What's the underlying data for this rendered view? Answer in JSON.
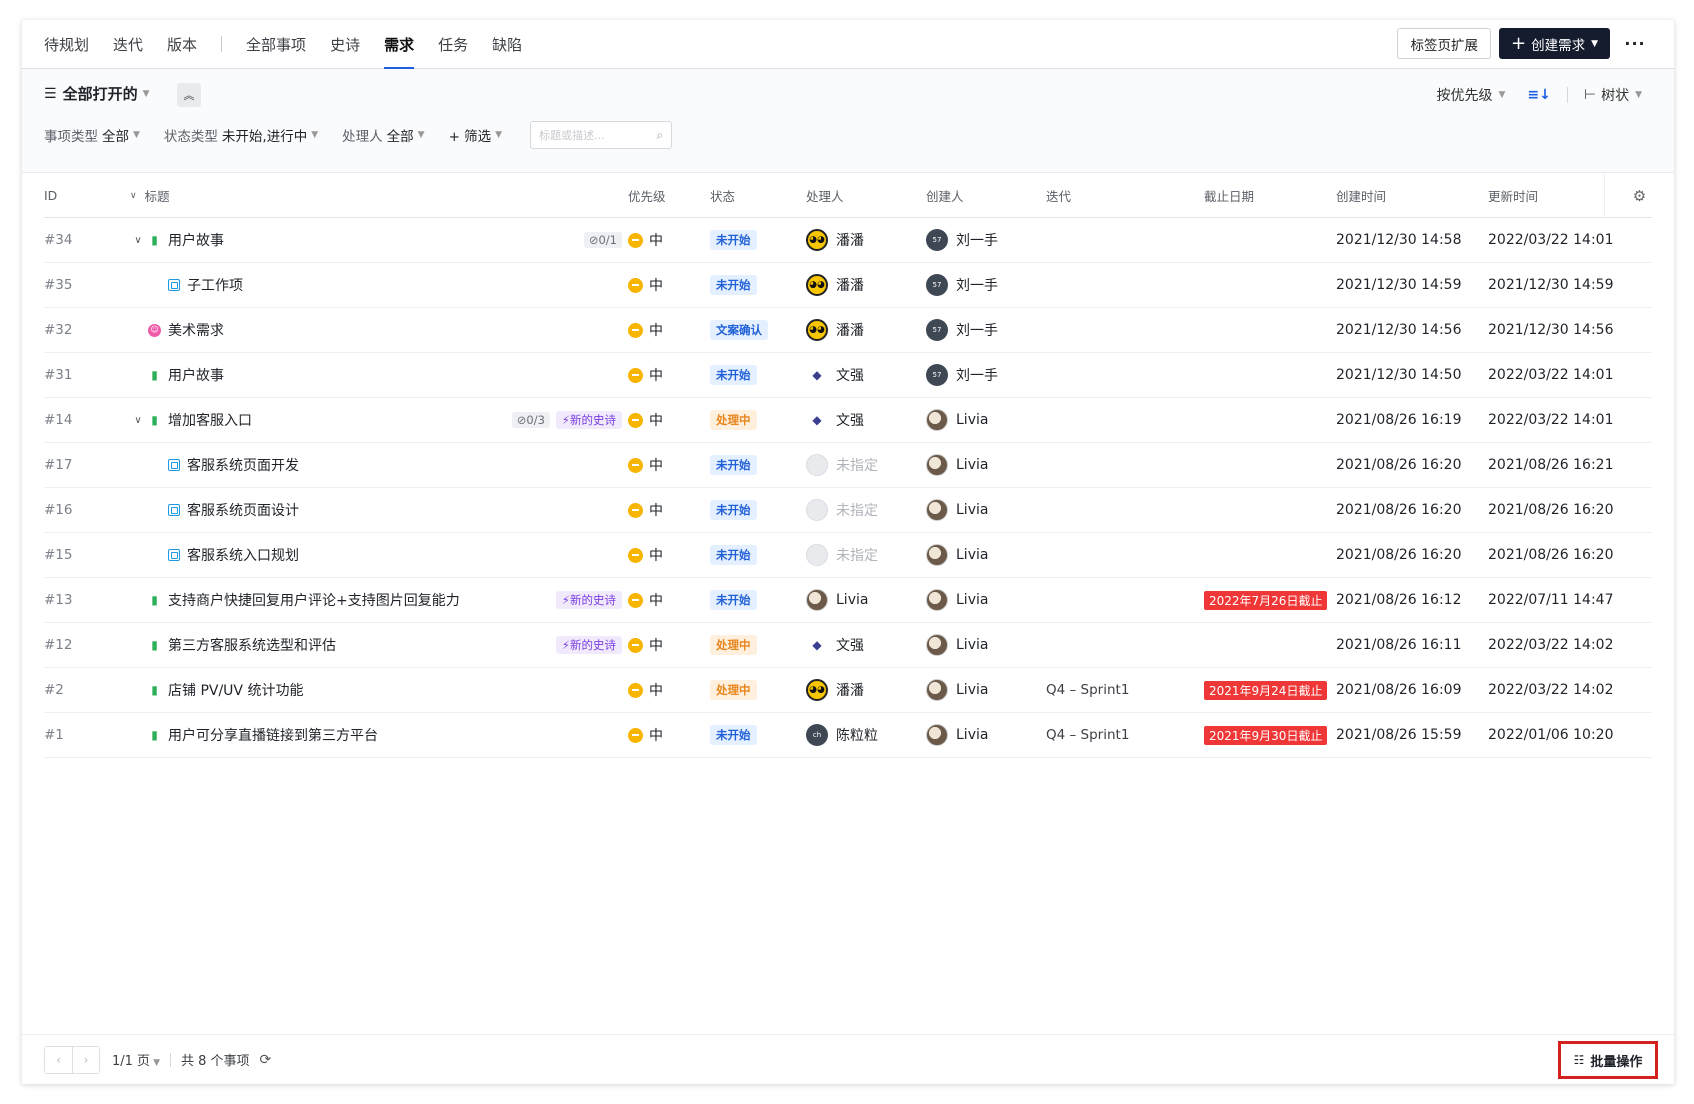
{
  "nav": {
    "tabs_left": [
      "待规划",
      "迭代",
      "版本"
    ],
    "tabs_right": [
      "全部事项",
      "史诗",
      "需求",
      "任务",
      "缺陷"
    ],
    "active_tab": "需求",
    "tab_extension_label": "标签页扩展",
    "create_label": "创建需求",
    "more_label": "···"
  },
  "filter": {
    "view_label": "全部打开的",
    "sort_label": "按优先级",
    "view_mode_label": "树状",
    "items": [
      {
        "label": "事项类型",
        "value": "全部"
      },
      {
        "label": "状态类型",
        "value": "未开始,进行中"
      },
      {
        "label": "处理人",
        "value": "全部"
      }
    ],
    "add_filter_label": "+ 筛选",
    "search_placeholder": "标题或描述..."
  },
  "table": {
    "columns": {
      "id": "ID",
      "title": "标题",
      "priority": "优先级",
      "status": "状态",
      "assignee": "处理人",
      "creator": "创建人",
      "iteration": "迭代",
      "due": "截止日期",
      "created": "创建时间",
      "updated": "更新时间"
    },
    "rows": [
      {
        "id": "#34",
        "level": 0,
        "expand": true,
        "type": "story",
        "title": "用户故事",
        "count": "0/1",
        "epic": "",
        "priority": "中",
        "status": "未开始",
        "status_color": "blue",
        "assignee": "潘潘",
        "assignee_avatar": "penguin",
        "creator": "刘一手",
        "creator_avatar": "dark",
        "iteration": "",
        "due": "",
        "created": "2021/12/30 14:58",
        "updated": "2022/03/22 14:01"
      },
      {
        "id": "#35",
        "level": 1,
        "expand": false,
        "type": "sub",
        "title": "子工作项",
        "count": "",
        "epic": "",
        "priority": "中",
        "status": "未开始",
        "status_color": "blue",
        "assignee": "潘潘",
        "assignee_avatar": "penguin",
        "creator": "刘一手",
        "creator_avatar": "dark",
        "iteration": "",
        "due": "",
        "created": "2021/12/30 14:59",
        "updated": "2021/12/30 14:59"
      },
      {
        "id": "#32",
        "level": 0,
        "expand": false,
        "type": "art",
        "title": "美术需求",
        "count": "",
        "epic": "",
        "priority": "中",
        "status": "文案确认",
        "status_color": "blue",
        "assignee": "潘潘",
        "assignee_avatar": "penguin",
        "creator": "刘一手",
        "creator_avatar": "dark",
        "iteration": "",
        "due": "",
        "created": "2021/12/30 14:56",
        "updated": "2021/12/30 14:56"
      },
      {
        "id": "#31",
        "level": 0,
        "expand": false,
        "type": "story",
        "title": "用户故事",
        "count": "",
        "epic": "",
        "priority": "中",
        "status": "未开始",
        "status_color": "blue",
        "assignee": "文强",
        "assignee_avatar": "cat",
        "creator": "刘一手",
        "creator_avatar": "dark",
        "iteration": "",
        "due": "",
        "created": "2021/12/30 14:50",
        "updated": "2022/03/22 14:01"
      },
      {
        "id": "#14",
        "level": 0,
        "expand": true,
        "type": "story",
        "title": "增加客服入口",
        "count": "0/3",
        "epic": "新的史诗",
        "priority": "中",
        "status": "处理中",
        "status_color": "orange",
        "assignee": "文强",
        "assignee_avatar": "cat",
        "creator": "Livia",
        "creator_avatar": "photo",
        "iteration": "",
        "due": "",
        "created": "2021/08/26 16:19",
        "updated": "2022/03/22 14:01"
      },
      {
        "id": "#17",
        "level": 1,
        "expand": false,
        "type": "sub",
        "title": "客服系统页面开发",
        "count": "",
        "epic": "",
        "priority": "中",
        "status": "未开始",
        "status_color": "blue",
        "assignee": "未指定",
        "assignee_avatar": "none",
        "creator": "Livia",
        "creator_avatar": "photo",
        "iteration": "",
        "due": "",
        "created": "2021/08/26 16:20",
        "updated": "2021/08/26 16:21"
      },
      {
        "id": "#16",
        "level": 1,
        "expand": false,
        "type": "sub",
        "title": "客服系统页面设计",
        "count": "",
        "epic": "",
        "priority": "中",
        "status": "未开始",
        "status_color": "blue",
        "assignee": "未指定",
        "assignee_avatar": "none",
        "creator": "Livia",
        "creator_avatar": "photo",
        "iteration": "",
        "due": "",
        "created": "2021/08/26 16:20",
        "updated": "2021/08/26 16:20"
      },
      {
        "id": "#15",
        "level": 1,
        "expand": false,
        "type": "sub",
        "title": "客服系统入口规划",
        "count": "",
        "epic": "",
        "priority": "中",
        "status": "未开始",
        "status_color": "blue",
        "assignee": "未指定",
        "assignee_avatar": "none",
        "creator": "Livia",
        "creator_avatar": "photo",
        "iteration": "",
        "due": "",
        "created": "2021/08/26 16:20",
        "updated": "2021/08/26 16:20"
      },
      {
        "id": "#13",
        "level": 0,
        "expand": false,
        "type": "story",
        "title": "支持商户快捷回复用户评论+支持图片回复能力",
        "count": "",
        "epic": "新的史诗",
        "priority": "中",
        "status": "未开始",
        "status_color": "blue",
        "assignee": "Livia",
        "assignee_avatar": "photo",
        "creator": "Livia",
        "creator_avatar": "photo",
        "iteration": "",
        "due": "2022年7月26日截止",
        "created": "2021/08/26 16:12",
        "updated": "2022/07/11 14:47"
      },
      {
        "id": "#12",
        "level": 0,
        "expand": false,
        "type": "story",
        "title": "第三方客服系统选型和评估",
        "count": "",
        "epic": "新的史诗",
        "priority": "中",
        "status": "处理中",
        "status_color": "orange",
        "assignee": "文强",
        "assignee_avatar": "cat",
        "creator": "Livia",
        "creator_avatar": "photo",
        "iteration": "",
        "due": "",
        "created": "2021/08/26 16:11",
        "updated": "2022/03/22 14:02"
      },
      {
        "id": "#2",
        "level": 0,
        "expand": false,
        "type": "story",
        "title": "店铺 PV/UV 统计功能",
        "count": "",
        "epic": "",
        "priority": "中",
        "status": "处理中",
        "status_color": "orange",
        "assignee": "潘潘",
        "assignee_avatar": "penguin",
        "creator": "Livia",
        "creator_avatar": "photo",
        "iteration": "Q4 – Sprint1",
        "due": "2021年9月24日截止",
        "created": "2021/08/26 16:09",
        "updated": "2022/03/22 14:02"
      },
      {
        "id": "#1",
        "level": 0,
        "expand": false,
        "type": "story",
        "title": "用户可分享直播链接到第三方平台",
        "count": "",
        "epic": "",
        "priority": "中",
        "status": "未开始",
        "status_color": "blue",
        "assignee": "陈粒粒",
        "assignee_avatar": "dark",
        "creator": "Livia",
        "creator_avatar": "photo",
        "iteration": "Q4 – Sprint1",
        "due": "2021年9月30日截止",
        "created": "2021/08/26 15:59",
        "updated": "2022/01/06 10:20"
      }
    ]
  },
  "footer": {
    "page_label": "1/1 页",
    "total_label": "共 8 个事项",
    "bulk_label": "批量操作"
  },
  "colors": {
    "accent": "#1c5fe3",
    "primary_button": "#141c2e",
    "priority_medium": "#f7b500",
    "due_red": "#f03737",
    "highlight_border": "#d4201f"
  }
}
